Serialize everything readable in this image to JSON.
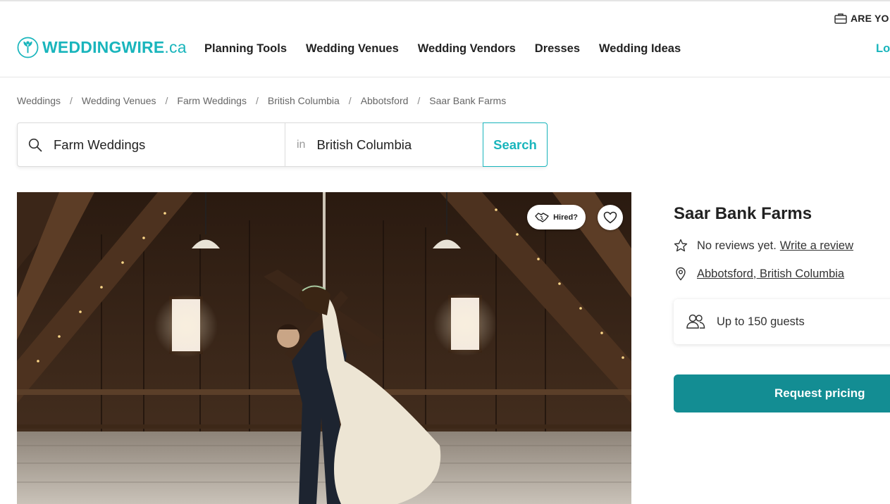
{
  "header": {
    "vendor_cta": "ARE YO",
    "logo": {
      "main": "WEDDINGWIRE",
      "suffix": ".ca"
    },
    "nav": [
      "Planning Tools",
      "Wedding Venues",
      "Wedding Vendors",
      "Dresses",
      "Wedding Ideas"
    ],
    "login": "Lo",
    "accent_color": "#19b5bc"
  },
  "breadcrumb": [
    "Weddings",
    "Wedding Venues",
    "Farm Weddings",
    "British Columbia",
    "Abbotsford",
    "Saar Bank Farms"
  ],
  "breadcrumb_separator": "/",
  "search": {
    "what_value": "Farm Weddings",
    "in_label": "in",
    "where_value": "British Columbia",
    "button_label": "Search"
  },
  "photo": {
    "hired_label": "Hired?",
    "icons": [
      "handshake-icon",
      "heart-icon"
    ]
  },
  "venue": {
    "name": "Saar Bank Farms",
    "reviews_text": "No reviews yet.",
    "review_link": "Write a review",
    "location": "Abbotsford, British Columbia",
    "guests": "Up to 150 guests",
    "pricing_button": "Request pricing",
    "button_color": "#138d93"
  }
}
